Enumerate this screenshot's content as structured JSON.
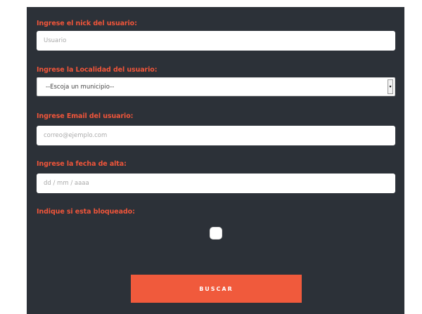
{
  "form": {
    "nick": {
      "label": "Ingrese el nick del usuario:",
      "placeholder": "Usuario"
    },
    "locality": {
      "label": "Ingrese la Localidad del usuario:",
      "selected": "--Escoja un municipio--"
    },
    "email": {
      "label": "Ingrese Email del usuario:",
      "placeholder": "correo@ejemplo.com"
    },
    "date": {
      "label": "Ingrese la fecha de alta:",
      "placeholder": "dd / mm / aaaa"
    },
    "blocked": {
      "label": "Indique si esta bloqueado:",
      "checked": false
    },
    "submit_label": "BUSCAR"
  },
  "colors": {
    "panel_bg": "#2c3138",
    "label": "#f0553a",
    "button": "#f05a3c"
  }
}
